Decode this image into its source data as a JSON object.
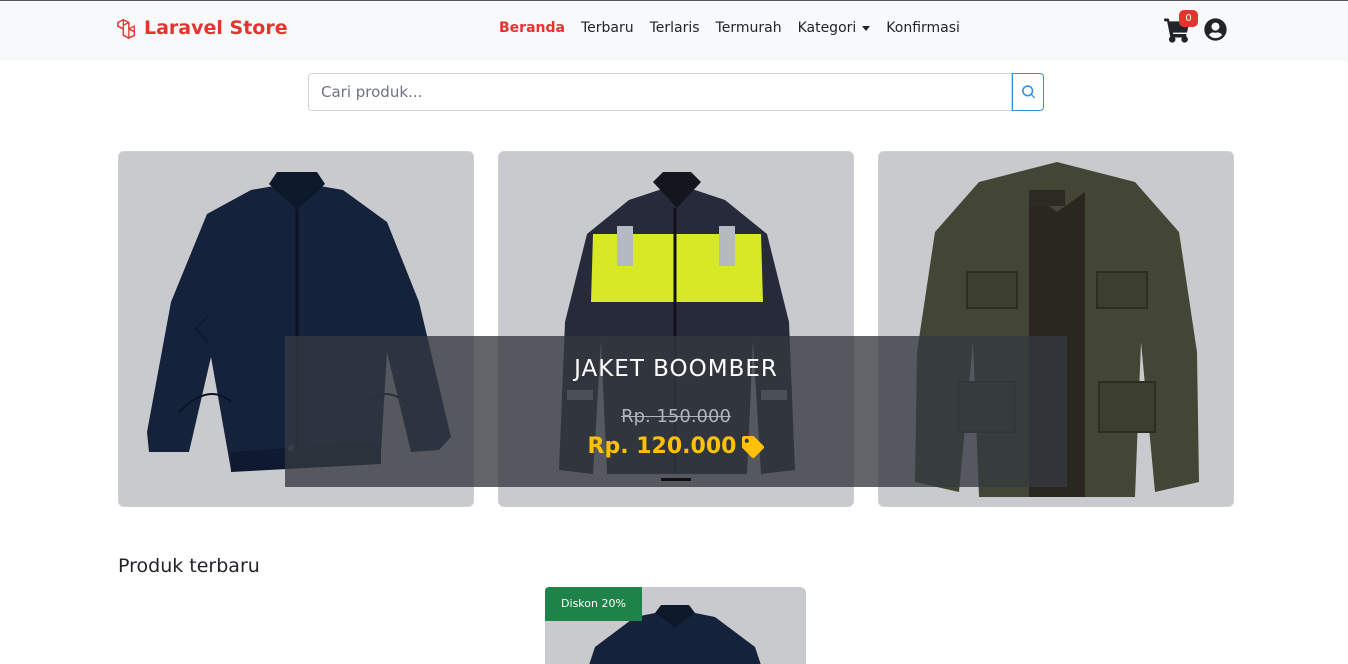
{
  "brand": {
    "name": "Laravel Store",
    "color": "#e3342f"
  },
  "nav": {
    "items": [
      {
        "label": "Beranda",
        "active": true
      },
      {
        "label": "Terbaru",
        "active": false
      },
      {
        "label": "Terlaris",
        "active": false
      },
      {
        "label": "Termurah",
        "active": false
      },
      {
        "label": "Kategori",
        "active": false,
        "dropdown": true
      },
      {
        "label": "Konfirmasi",
        "active": false
      }
    ],
    "cart_count": "0",
    "icons": {
      "cart": "cart-icon",
      "user": "user-circle-icon"
    }
  },
  "search": {
    "placeholder": "Cari produk...",
    "icon": "search-icon",
    "accent": "#3490dc"
  },
  "carousel": {
    "caption": {
      "title": "JAKET BOOMBER",
      "old_price": "Rp. 150.000",
      "new_price": "Rp. 120.000",
      "tag_icon": "price-tag-icon",
      "price_color": "#ffc107"
    },
    "slides": [
      {
        "name": "navy-bomber-jacket",
        "color": "#1b2a47"
      },
      {
        "name": "hi-vis-work-jacket",
        "color": "#2b2e3d"
      },
      {
        "name": "olive-field-jacket",
        "color": "#4a4d3a"
      }
    ]
  },
  "section": {
    "title": "Produk terbaru"
  },
  "product": {
    "discount_label": "Diskon 20%",
    "discount_color": "#1d8348"
  }
}
